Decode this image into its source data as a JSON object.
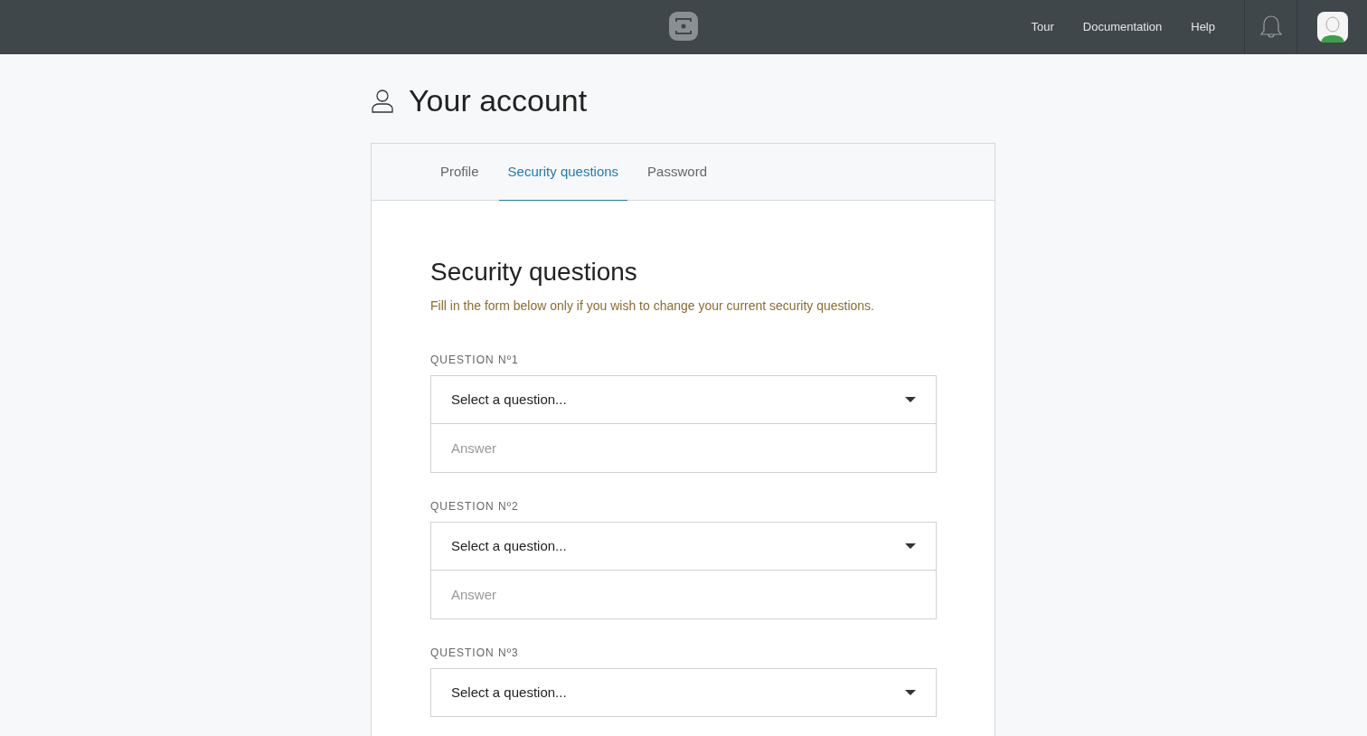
{
  "nav": {
    "links": [
      "Tour",
      "Documentation",
      "Help"
    ]
  },
  "page": {
    "title": "Your account"
  },
  "tabs": [
    {
      "label": "Profile",
      "selected": false
    },
    {
      "label": "Security questions",
      "selected": true
    },
    {
      "label": "Password",
      "selected": false
    }
  ],
  "section": {
    "title": "Security questions",
    "hint": "Fill in the form below only if you wish to change your current security questions."
  },
  "questions": [
    {
      "label": "QUESTION Nº1",
      "select": "Select a question...",
      "placeholder": "Answer"
    },
    {
      "label": "QUESTION Nº2",
      "select": "Select a question...",
      "placeholder": "Answer"
    },
    {
      "label": "QUESTION Nº3",
      "select": "Select a question..."
    }
  ]
}
